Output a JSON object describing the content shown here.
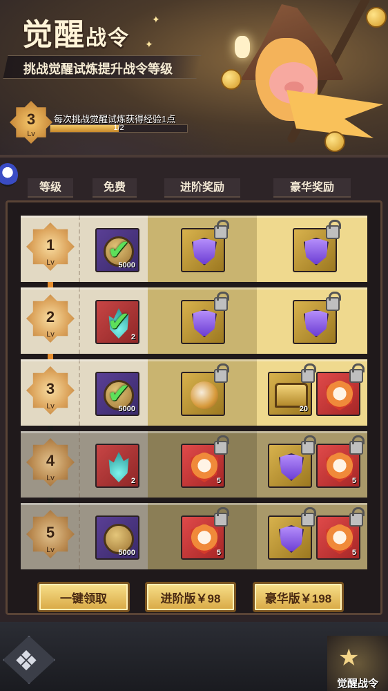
{
  "header": {
    "title_part1": "觉醒",
    "title_part2": "战令",
    "subtitle": "挑战觉醒试炼提升战令等级"
  },
  "progress": {
    "level": "3",
    "lv_label": "Lv",
    "tip": "每次挑战觉醒试炼获得经验1点",
    "text": "1/2",
    "fraction": 0.5
  },
  "columns": {
    "level": "等级",
    "free": "免费",
    "advanced": "进阶奖励",
    "luxury": "豪华奖励"
  },
  "rows": [
    {
      "level": "1",
      "lv": "Lv",
      "free": {
        "icon": "coin-icon",
        "qty": "5000",
        "claimed": true
      },
      "advanced": [
        {
          "icon": "purple-shield-icon",
          "qty": "",
          "locked": true
        }
      ],
      "luxury": [
        {
          "icon": "purple-shield-icon",
          "qty": "",
          "locked": true
        }
      ]
    },
    {
      "level": "2",
      "lv": "Lv",
      "free": {
        "icon": "flame-icon",
        "qty": "2",
        "claimed": true
      },
      "advanced": [
        {
          "icon": "purple-shield-icon",
          "qty": "",
          "locked": true
        }
      ],
      "luxury": [
        {
          "icon": "purple-shield-icon",
          "qty": "",
          "locked": true
        }
      ]
    },
    {
      "level": "3",
      "lv": "Lv",
      "free": {
        "icon": "coin-icon",
        "qty": "5000",
        "claimed": true
      },
      "advanced": [
        {
          "icon": "orb-icon",
          "qty": "",
          "locked": true
        }
      ],
      "luxury": [
        {
          "icon": "treasure-chest-icon",
          "qty": "20",
          "locked": true
        },
        {
          "icon": "crimson-badge-icon",
          "qty": "",
          "locked": true
        }
      ]
    },
    {
      "level": "4",
      "lv": "Lv",
      "free": {
        "icon": "flame-icon",
        "qty": "2",
        "claimed": false
      },
      "advanced": [
        {
          "icon": "crimson-badge-icon",
          "qty": "5",
          "locked": true
        }
      ],
      "luxury": [
        {
          "icon": "purple-shield-icon",
          "qty": "",
          "locked": true
        },
        {
          "icon": "crimson-badge-icon",
          "qty": "5",
          "locked": true
        }
      ]
    },
    {
      "level": "5",
      "lv": "Lv",
      "free": {
        "icon": "coin-icon",
        "qty": "5000",
        "claimed": false
      },
      "advanced": [
        {
          "icon": "crimson-badge-icon",
          "qty": "5",
          "locked": true
        }
      ],
      "luxury": [
        {
          "icon": "purple-shield-icon",
          "qty": "",
          "locked": true
        },
        {
          "icon": "crimson-badge-icon",
          "qty": "5",
          "locked": true
        }
      ]
    }
  ],
  "buttons": {
    "claim_all": "一键领取",
    "advanced": "进阶版￥98",
    "luxury": "豪华版￥198"
  },
  "footer": {
    "right_label": "觉醒战令"
  },
  "colors": {
    "claimed_check": "#5de05a",
    "button_gold": "#f8e08a",
    "frame": "#2d2427"
  }
}
